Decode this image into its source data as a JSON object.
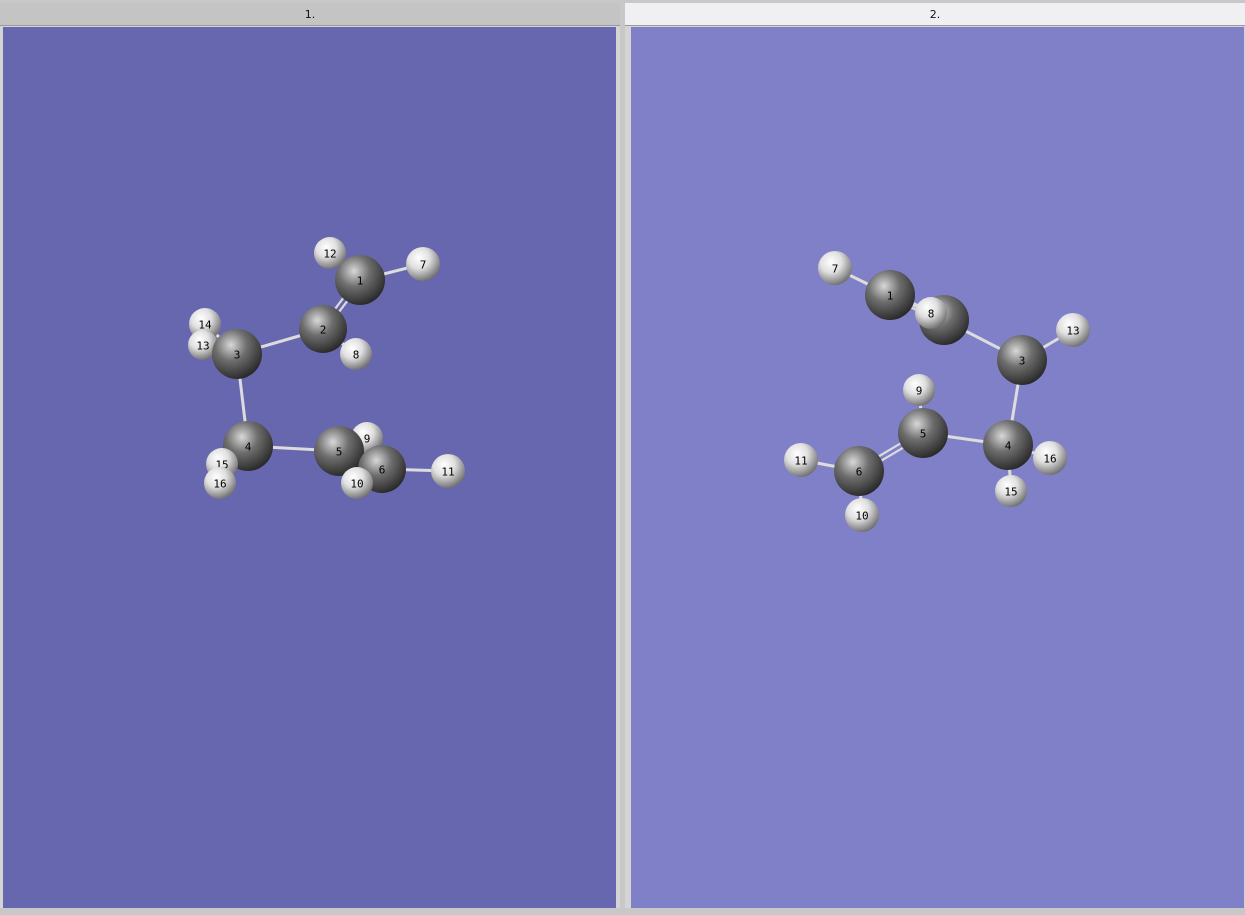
{
  "colors": {
    "viewer1_background": "#6767b0",
    "viewer2_background": "#8080c8",
    "carbon": "#6e6e6e",
    "hydrogen": "#e0e0e0",
    "bond": "#dcdcdc"
  },
  "windows": [
    {
      "title": "1.",
      "atoms": [
        {
          "id": "12",
          "element": "H"
        },
        {
          "id": "1",
          "element": "C"
        },
        {
          "id": "7",
          "element": "H"
        },
        {
          "id": "14",
          "element": "H"
        },
        {
          "id": "13",
          "element": "H"
        },
        {
          "id": "3",
          "element": "C"
        },
        {
          "id": "2",
          "element": "C"
        },
        {
          "id": "8",
          "element": "H"
        },
        {
          "id": "4",
          "element": "C"
        },
        {
          "id": "9",
          "element": "H"
        },
        {
          "id": "5",
          "element": "C"
        },
        {
          "id": "6",
          "element": "C"
        },
        {
          "id": "11",
          "element": "H"
        },
        {
          "id": "15",
          "element": "H"
        },
        {
          "id": "16",
          "element": "H"
        },
        {
          "id": "10",
          "element": "H"
        }
      ]
    },
    {
      "title": "2.",
      "atoms": [
        {
          "id": "7",
          "element": "H"
        },
        {
          "id": "1",
          "element": "C"
        },
        {
          "id": "8",
          "element": "H"
        },
        {
          "id": "13",
          "element": "H"
        },
        {
          "id": "3",
          "element": "C"
        },
        {
          "id": "9",
          "element": "H"
        },
        {
          "id": "5",
          "element": "C"
        },
        {
          "id": "4",
          "element": "C"
        },
        {
          "id": "16",
          "element": "H"
        },
        {
          "id": "15",
          "element": "H"
        },
        {
          "id": "11",
          "element": "H"
        },
        {
          "id": "6",
          "element": "C"
        },
        {
          "id": "10",
          "element": "H"
        }
      ]
    }
  ]
}
